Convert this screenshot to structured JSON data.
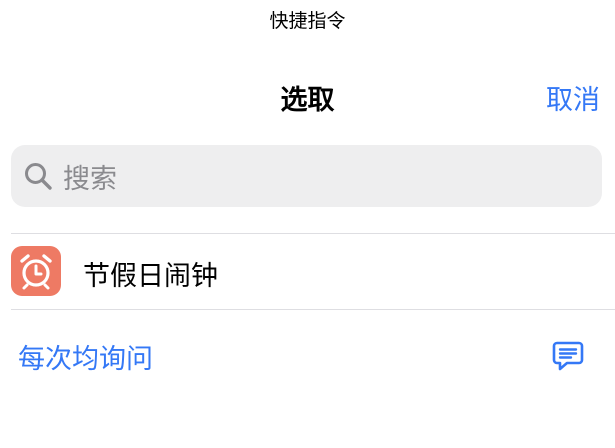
{
  "status_bar": {
    "title": "快捷指令"
  },
  "nav": {
    "title": "选取",
    "cancel_label": "取消"
  },
  "search": {
    "placeholder": "搜索",
    "icon": "search-icon"
  },
  "list": {
    "items": [
      {
        "label": "节假日闹钟",
        "icon": "alarm-clock-icon",
        "icon_color": "#ee7a64"
      }
    ]
  },
  "ask_each_time": {
    "label": "每次均询问",
    "icon": "comment-icon"
  },
  "colors": {
    "accent": "#3478f6",
    "search_bg": "#eeeeef",
    "placeholder": "#8a8a8e"
  }
}
